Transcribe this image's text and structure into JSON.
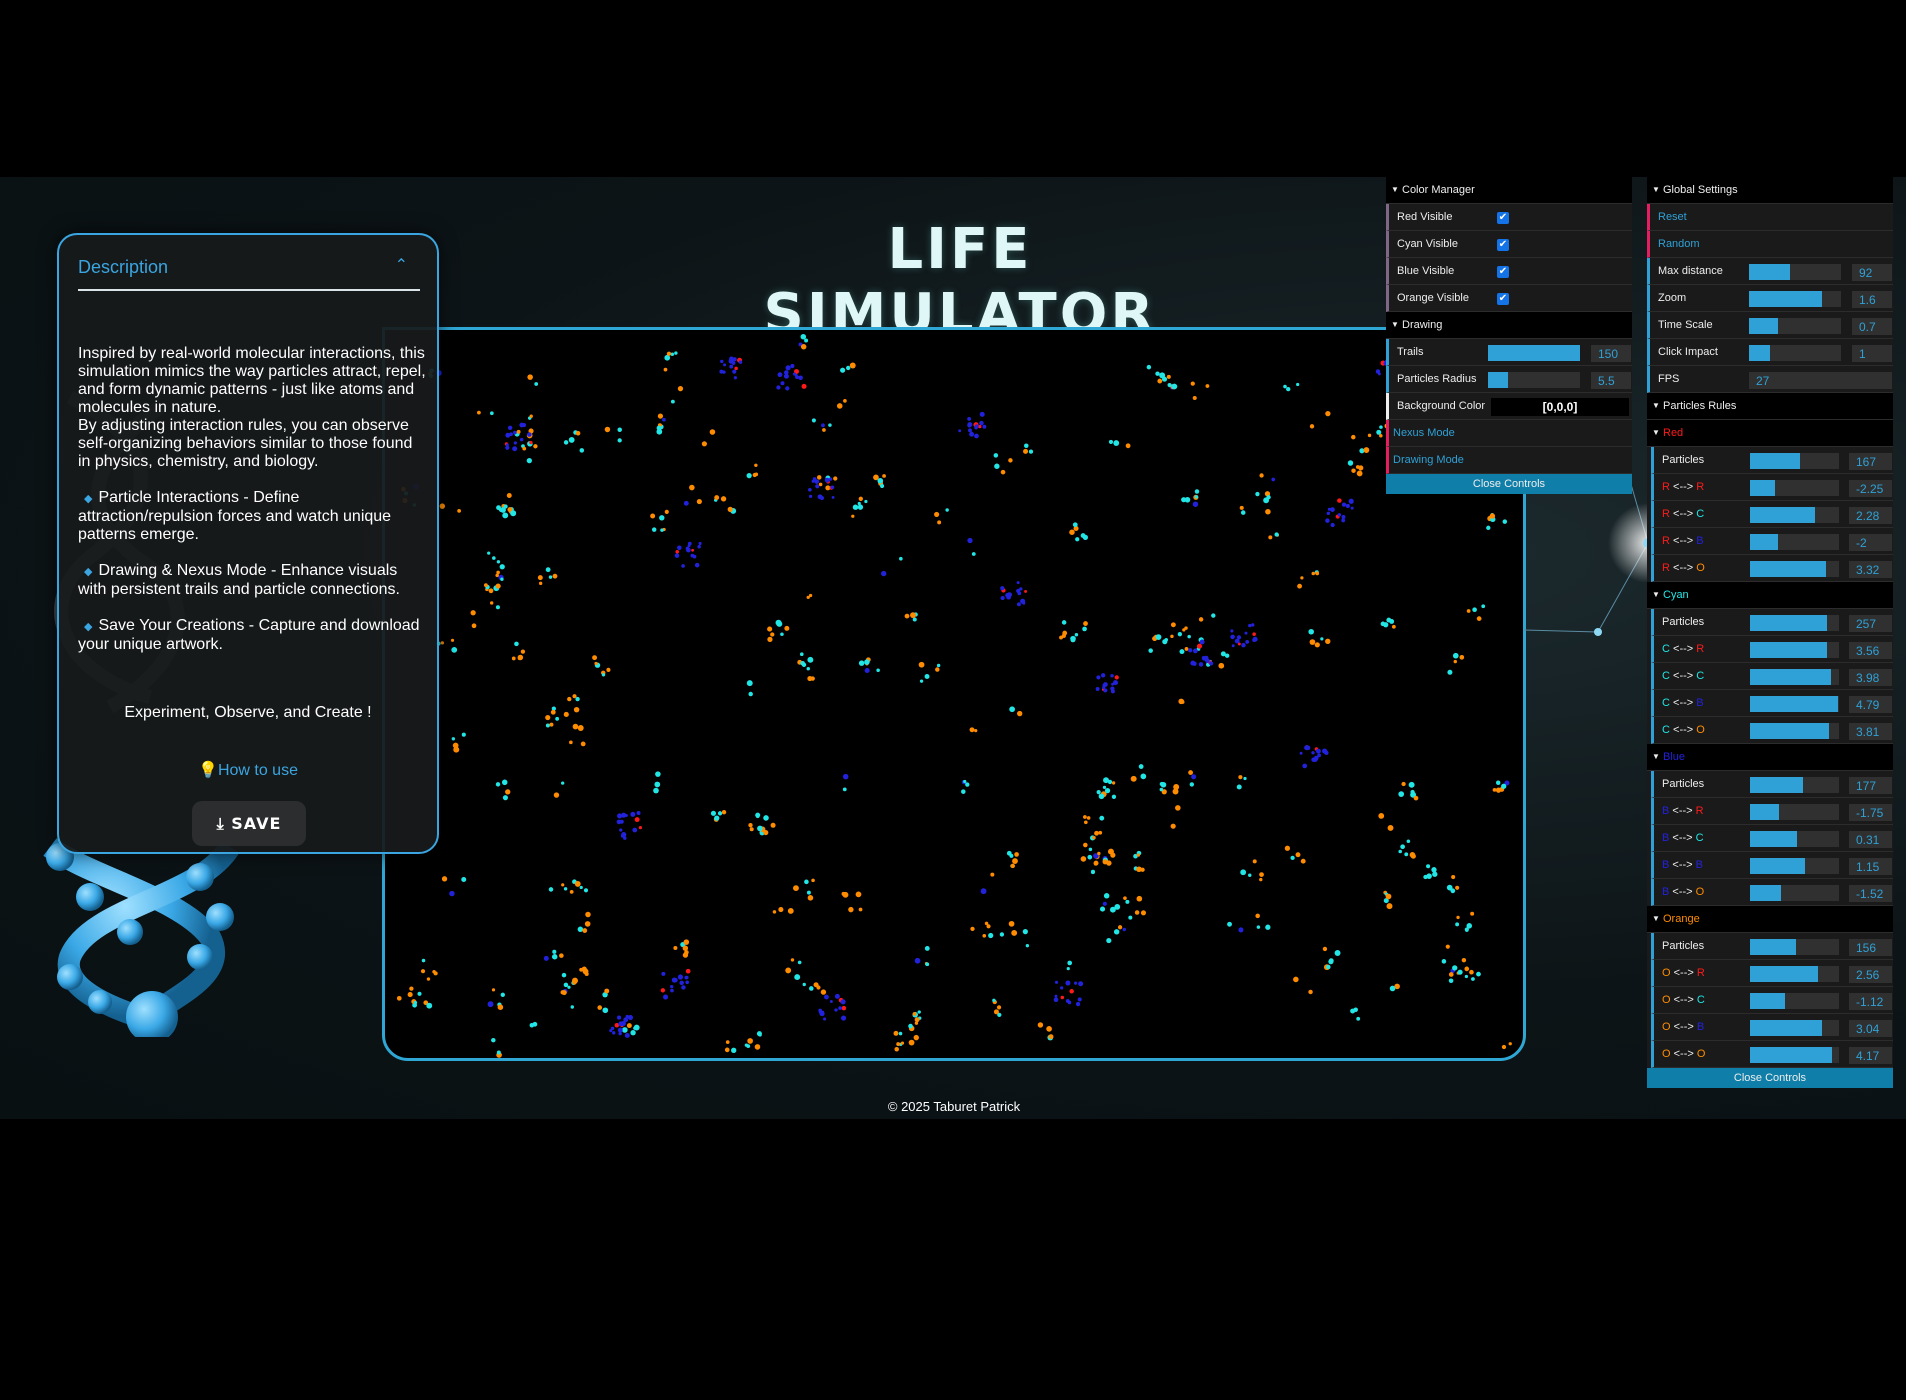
{
  "app": {
    "title": "LIFE SIMULATOR",
    "footer": "© 2025 Taburet Patrick"
  },
  "description": {
    "header": "Description",
    "intro": "Inspired by real-world molecular interactions, this simulation mimics the way particles attract, repel, and form dynamic patterns - just like atoms and molecules in nature.",
    "intro2": "By adjusting interaction rules, you can observe self-organizing behaviors similar to those found in physics, chemistry, and biology.",
    "features": [
      "Particle Interactions - Define attraction/repulsion forces and watch unique patterns emerge.",
      "Drawing & Nexus Mode - Enhance visuals with persistent trails and particle connections.",
      "Save Your Creations - Capture and download your unique artwork."
    ],
    "motto": "Experiment, Observe, and Create !",
    "how_to_use": "How to use",
    "save_label": "SAVE"
  },
  "color_manager": {
    "title": "Color Manager",
    "items": [
      {
        "label": "Red Visible",
        "checked": true
      },
      {
        "label": "Cyan Visible",
        "checked": true
      },
      {
        "label": "Blue Visible",
        "checked": true
      },
      {
        "label": "Orange Visible",
        "checked": true
      }
    ]
  },
  "drawing": {
    "title": "Drawing",
    "trails": {
      "label": "Trails",
      "value": "150",
      "fraction": 1.0
    },
    "radius": {
      "label": "Particles Radius",
      "value": "5.5",
      "fraction": 0.22
    },
    "background": {
      "label": "Background Color",
      "value": "[0,0,0]"
    },
    "nexus": "Nexus Mode",
    "drawing_mode": "Drawing Mode",
    "close": "Close Controls"
  },
  "global": {
    "title": "Global Settings",
    "reset": "Reset",
    "random": "Random",
    "sliders": [
      {
        "label": "Max distance",
        "value": "92",
        "fraction": 0.45
      },
      {
        "label": "Zoom",
        "value": "1.6",
        "fraction": 0.79
      },
      {
        "label": "Time Scale",
        "value": "0.7",
        "fraction": 0.31
      },
      {
        "label": "Click Impact",
        "value": "1",
        "fraction": 0.23
      }
    ],
    "fps": {
      "label": "FPS",
      "value": "27"
    }
  },
  "rules": {
    "title": "Particles Rules",
    "groups": [
      {
        "name": "Red",
        "color": "#ff1a1a",
        "rows": [
          {
            "a": "",
            "b": "",
            "label": "Particles",
            "value": "167",
            "fraction": 0.56
          },
          {
            "a": "R",
            "b": "R",
            "label": "<-->",
            "value": "-2.25",
            "fraction": 0.28
          },
          {
            "a": "R",
            "b": "C",
            "label": "<-->",
            "value": "2.28",
            "fraction": 0.73
          },
          {
            "a": "R",
            "b": "B",
            "label": "<-->",
            "value": "-2",
            "fraction": 0.31
          },
          {
            "a": "R",
            "b": "O",
            "label": "<-->",
            "value": "3.32",
            "fraction": 0.85
          }
        ]
      },
      {
        "name": "Cyan",
        "color": "#22e5e5",
        "rows": [
          {
            "a": "",
            "b": "",
            "label": "Particles",
            "value": "257",
            "fraction": 0.86
          },
          {
            "a": "C",
            "b": "R",
            "label": "<-->",
            "value": "3.56",
            "fraction": 0.87
          },
          {
            "a": "C",
            "b": "C",
            "label": "<-->",
            "value": "3.98",
            "fraction": 0.91
          },
          {
            "a": "C",
            "b": "B",
            "label": "<-->",
            "value": "4.79",
            "fraction": 0.99
          },
          {
            "a": "C",
            "b": "O",
            "label": "<-->",
            "value": "3.81",
            "fraction": 0.89
          }
        ]
      },
      {
        "name": "Blue",
        "color": "#2222dd",
        "rows": [
          {
            "a": "",
            "b": "",
            "label": "Particles",
            "value": "177",
            "fraction": 0.59
          },
          {
            "a": "B",
            "b": "R",
            "label": "<-->",
            "value": "-1.75",
            "fraction": 0.33
          },
          {
            "a": "B",
            "b": "C",
            "label": "<-->",
            "value": "0.31",
            "fraction": 0.53
          },
          {
            "a": "B",
            "b": "B",
            "label": "<-->",
            "value": "1.15",
            "fraction": 0.62
          },
          {
            "a": "B",
            "b": "O",
            "label": "<-->",
            "value": "-1.52",
            "fraction": 0.35
          }
        ]
      },
      {
        "name": "Orange",
        "color": "#ff8c00",
        "rows": [
          {
            "a": "",
            "b": "",
            "label": "Particles",
            "value": "156",
            "fraction": 0.52
          },
          {
            "a": "O",
            "b": "R",
            "label": "<-->",
            "value": "2.56",
            "fraction": 0.76
          },
          {
            "a": "O",
            "b": "C",
            "label": "<-->",
            "value": "-1.12",
            "fraction": 0.39
          },
          {
            "a": "O",
            "b": "B",
            "label": "<-->",
            "value": "3.04",
            "fraction": 0.81
          },
          {
            "a": "O",
            "b": "O",
            "label": "<-->",
            "value": "4.17",
            "fraction": 0.92
          }
        ]
      }
    ],
    "close": "Close Controls"
  },
  "colors": {
    "accent": "#2fa1d6",
    "canvas_border": "#2fa7d4",
    "red": "#ff1a1a",
    "cyan": "#22e5e5",
    "blue": "#2222dd",
    "orange": "#ff8c00"
  }
}
